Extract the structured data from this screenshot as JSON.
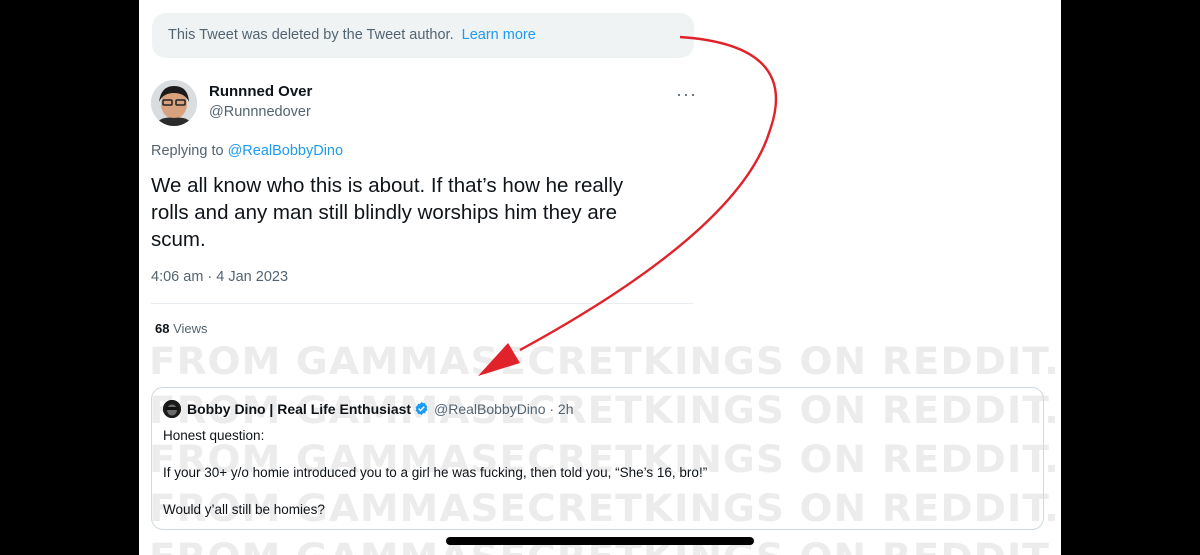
{
  "deleted_notice": {
    "text": "This Tweet was deleted by the Tweet author.",
    "link": "Learn more"
  },
  "tweet": {
    "author_name": "Runnned Over",
    "author_handle": "@Runnnedover",
    "more_label": "···",
    "replying_prefix": "Replying to",
    "replying_handle": "@RealBobbyDino",
    "lines": [
      "We all know who this is about. If that’s how he really",
      "rolls and any man still blindly worships him they are",
      "scum."
    ],
    "timestamp": "4:06 am · 4 Jan 2023",
    "views_count": "68",
    "views_label": "Views"
  },
  "quote": {
    "name": "Bobby Dino | Real Life Enthusiast",
    "handle": "@RealBobbyDino · 2h",
    "line1": "Honest question:",
    "line2": "If your 30+ y/o homie introduced you to a girl he was fucking, then told you, “She’s 16, bro!”",
    "line3": "Would y’all still be homies?"
  },
  "watermark": {
    "text": "FROM GAMMASECRETKINGS ON REDDIT.COM"
  },
  "colors": {
    "arrow": "#e0232a",
    "link": "#1d9bf0",
    "muted": "#536471"
  }
}
